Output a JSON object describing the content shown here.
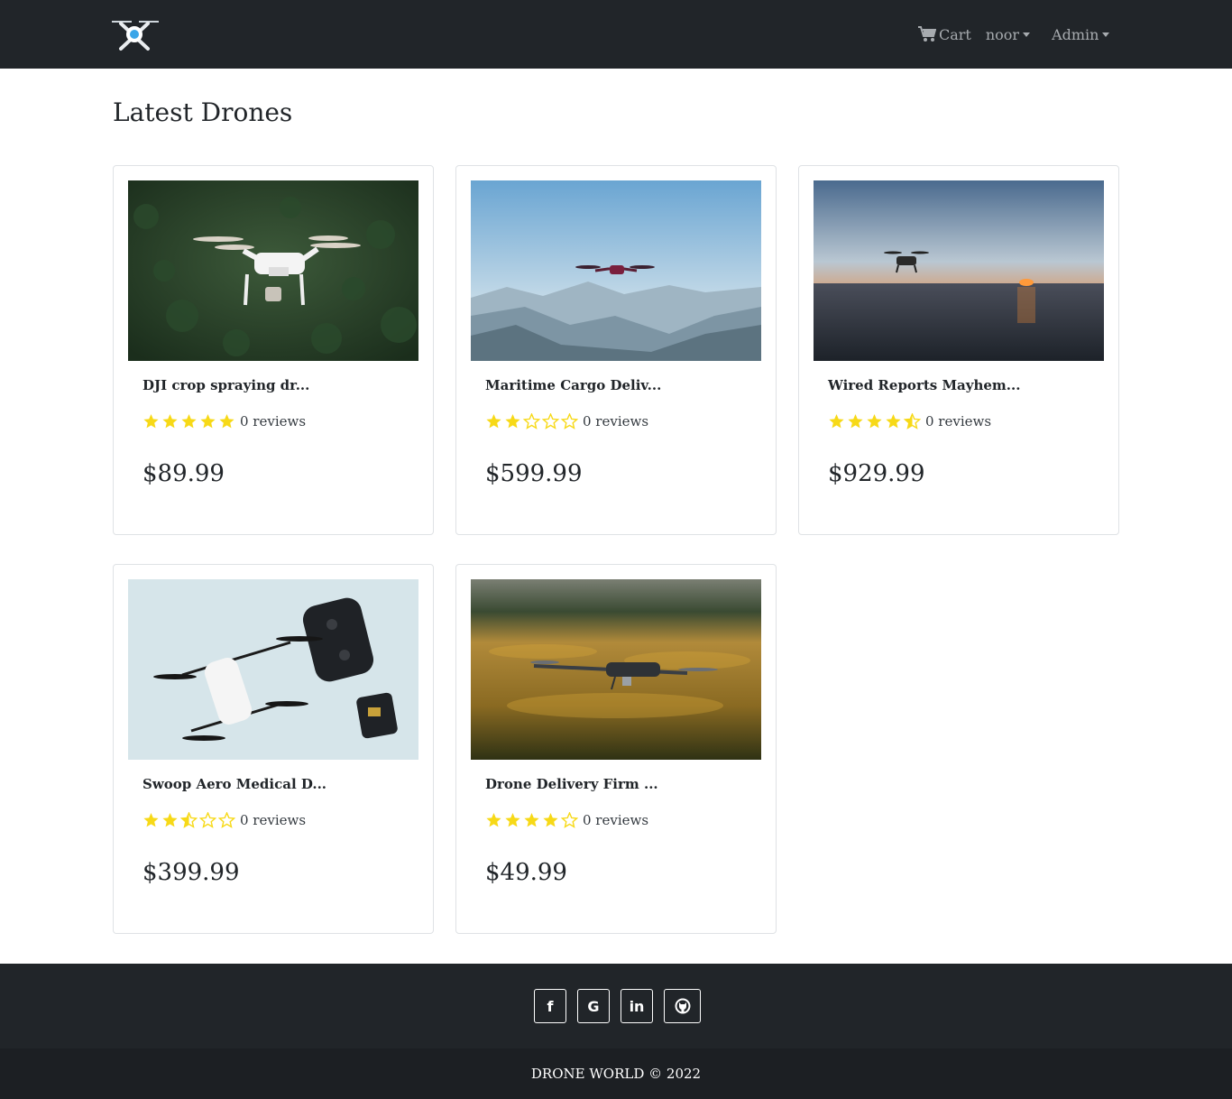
{
  "nav": {
    "cart_label": "Cart",
    "user_label": "noor",
    "admin_label": "Admin"
  },
  "page": {
    "title": "Latest Drones"
  },
  "products": [
    {
      "title": "DJI crop spraying dr...",
      "rating": 5,
      "reviews": "0 reviews",
      "price": "$89.99",
      "image": "drone-over-forest"
    },
    {
      "title": "Maritime Cargo Deliv...",
      "rating": 2,
      "reviews": "0 reviews",
      "price": "$599.99",
      "image": "drone-over-mountains"
    },
    {
      "title": "Wired Reports Mayhem...",
      "rating": 4.5,
      "reviews": "0 reviews",
      "price": "$929.99",
      "image": "drone-over-sea-sunset"
    },
    {
      "title": "Swoop Aero Medical D...",
      "rating": 2.5,
      "reviews": "0 reviews",
      "price": "$399.99",
      "image": "drone-with-controller"
    },
    {
      "title": "Drone Delivery Firm ...",
      "rating": 4,
      "reviews": "0 reviews",
      "price": "$49.99",
      "image": "drone-over-field"
    }
  ],
  "footer": {
    "social": [
      {
        "label": "f",
        "icon": "facebook-icon"
      },
      {
        "label": "G",
        "icon": "google-icon"
      },
      {
        "label": "in",
        "icon": "linkedin-icon"
      },
      {
        "label": "",
        "icon": "github-icon"
      }
    ],
    "copyright": "DRONE WORLD © 2022"
  },
  "colors": {
    "navbar": "#212529",
    "star": "#f7d917",
    "footer_bottom": "#1c1f23"
  }
}
